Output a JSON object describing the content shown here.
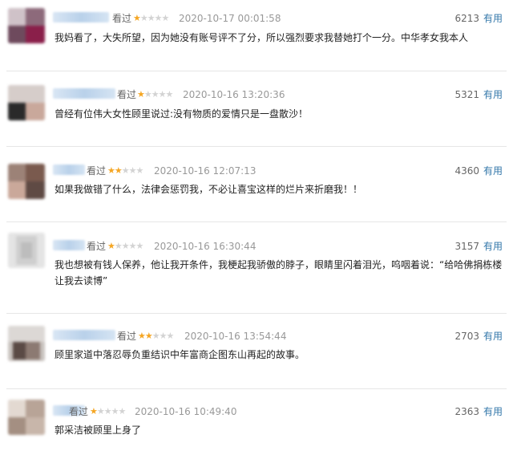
{
  "reviews": [
    {
      "watched": "看过",
      "rating": 1,
      "date": "2020-10-17 00:01:58",
      "votes": "6213",
      "useful": "有用",
      "text": "我妈看了，大失所望，因为她没有账号评不了分，所以强烈要求我替她打个一分。中华孝女我本人"
    },
    {
      "watched": "看过",
      "rating": 1,
      "date": "2020-10-16 13:20:36",
      "votes": "5321",
      "useful": "有用",
      "text": "曾经有位伟大女性顾里说过:没有物质的爱情只是一盘散沙！"
    },
    {
      "watched": "看过",
      "rating": 2,
      "date": "2020-10-16 12:07:13",
      "votes": "4360",
      "useful": "有用",
      "text": "如果我做错了什么，法律会惩罚我，不必让喜宝这样的烂片来折磨我！！"
    },
    {
      "watched": "看过",
      "rating": 1,
      "date": "2020-10-16 16:30:44",
      "votes": "3157",
      "useful": "有用",
      "text": "我也想被有钱人保养，他让我开条件，我梗起我骄傲的脖子，眼睛里闪着泪光，呜咽着说：“给哈佛捐栋楼让我去读博”"
    },
    {
      "watched": "看过",
      "rating": 2,
      "date": "2020-10-16 13:54:44",
      "votes": "2703",
      "useful": "有用",
      "text": "顾里家道中落忍辱负重结识中年富商企图东山再起的故事。"
    },
    {
      "watched": "看过",
      "rating": 1,
      "date": "2020-10-16 10:49:40",
      "votes": "2363",
      "useful": "有用",
      "text": "郭采洁被顾里上身了"
    }
  ]
}
